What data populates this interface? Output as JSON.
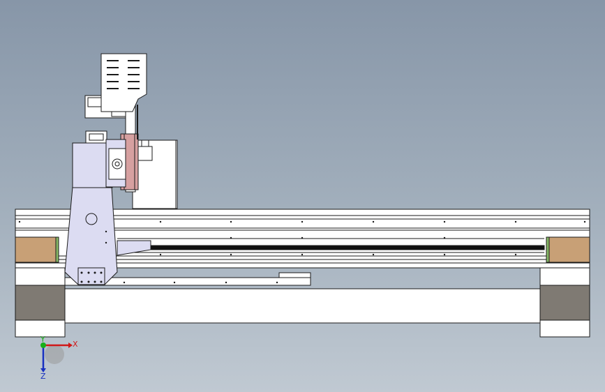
{
  "viewport": {
    "background_top": "#8796a8",
    "background_bottom": "#c0c9d2"
  },
  "colors": {
    "outline": "#1a1a1a",
    "carriage": "#dcdcf2",
    "z_plate": "#d6a0a0",
    "wood_insert": "#c8a076",
    "dark_block": "#7f7a73",
    "rail_green": "#88b866",
    "axis_x": "#d01818",
    "axis_y": "#18b018",
    "axis_z": "#1830c0"
  },
  "triad": {
    "x_label": "X",
    "y_label": "Y",
    "z_label": "Z"
  }
}
